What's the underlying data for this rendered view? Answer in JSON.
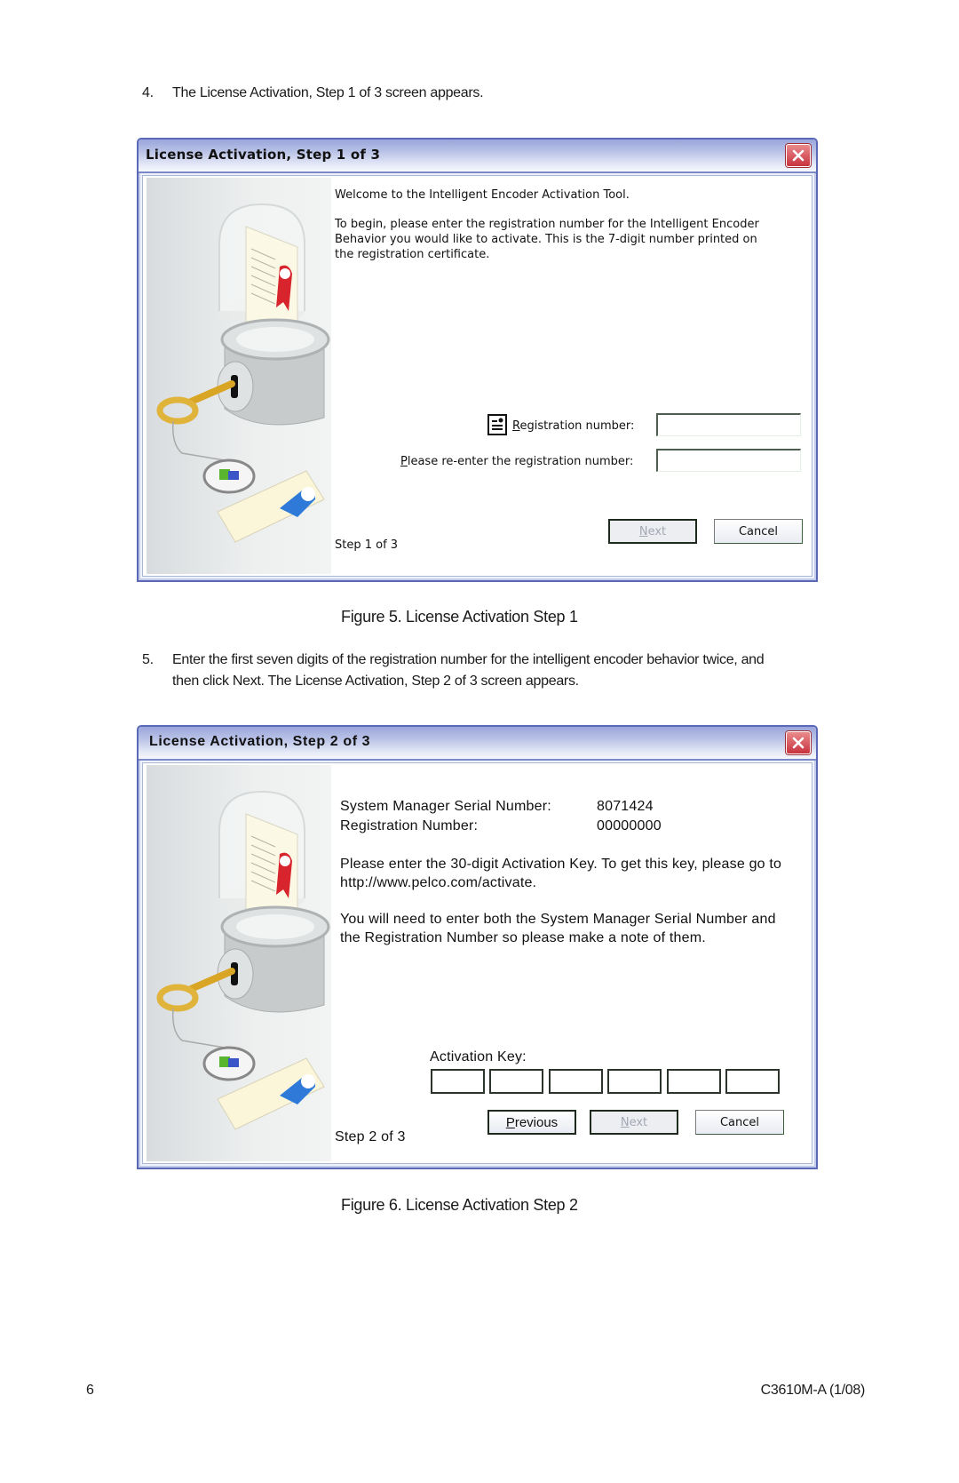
{
  "document": {
    "steps": [
      {
        "number": "4.",
        "text": "The License Activation, Step 1 of 3 screen appears."
      },
      {
        "number": "5.",
        "line1": "Enter the first seven digits of the registration number for the intelligent encoder behavior twice, and",
        "line2": "then click Next. The License Activation, Step 2 of 3 screen appears."
      }
    ],
    "figures": [
      {
        "caption": "Figure 5.  License Activation Step 1"
      },
      {
        "caption": "Figure 6.  License Activation Step 2"
      }
    ],
    "footer": {
      "page_number": "6",
      "doc_id": "C3610M-A (1/08)"
    }
  },
  "dialog1": {
    "title": "License Activation, Step 1 of 3",
    "welcome": "Welcome to the Intelligent Encoder Activation Tool.",
    "instructions": "To begin, please enter the registration number for the Intelligent Encoder Behavior you would like to activate. This is the 7-digit number printed on the registration certificate.",
    "registration_label_first": "R",
    "registration_label_rest": "egistration number:",
    "reenter_label_first": "P",
    "reenter_label_rest": "lease re-enter the registration number:",
    "registration_value": "",
    "reenter_value": "",
    "step_text": "Step 1 of 3",
    "buttons": {
      "next_first": "N",
      "next_rest": "ext",
      "cancel": "Cancel"
    },
    "icons": {
      "close": "close-icon",
      "form": "document-form-icon",
      "illustration": "license-illustration"
    }
  },
  "dialog2": {
    "title": "License Activation, Step 2 of 3",
    "serial_label": "System Manager Serial Number:",
    "serial_value": "8071424",
    "registration_label": "Registration Number:",
    "registration_value": "00000000",
    "para1": "Please enter the 30-digit Activation Key. To get this key, please go to http://www.pelco.com/activate.",
    "para2": "You will need to enter both the System Manager Serial Number and the Registration Number so please make a note of them.",
    "activation_key_label": "Activation Key:",
    "activation_key_fields": [
      "",
      "",
      "",
      "",
      "",
      ""
    ],
    "step_text": "Step 2 of 3",
    "buttons": {
      "previous_first": "P",
      "previous_rest": "revious",
      "next_first": "N",
      "next_rest": "ext",
      "cancel": "Cancel"
    }
  },
  "colors": {
    "title_gradient_top": "#9aa6db",
    "window_border": "#5a68b8",
    "close_red": "#c8323e",
    "disabled_text": "#a3a8b3"
  }
}
